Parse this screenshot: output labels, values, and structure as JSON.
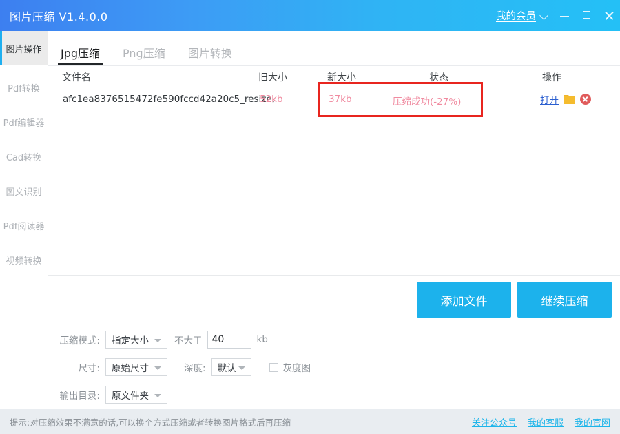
{
  "titlebar": {
    "app_title": "图片压缩 V1.4.0.0",
    "member_link": "我的会员",
    "chevron_icon": "chevron-down-icon",
    "minimize_icon": "minimize-icon",
    "maximize_icon": "maximize-icon",
    "close_icon": "close-icon",
    "gradient_start": "#3d7ff0",
    "gradient_end": "#24c0f6"
  },
  "sidebar": {
    "items": [
      {
        "label": "图片操作",
        "active": true
      },
      {
        "label": "Pdf转换",
        "active": false
      },
      {
        "label": "Pdf编辑器",
        "active": false
      },
      {
        "label": "Cad转换",
        "active": false
      },
      {
        "label": "图文识别",
        "active": false
      },
      {
        "label": "Pdf阅读器",
        "active": false
      },
      {
        "label": "视频转换",
        "active": false
      }
    ],
    "active_accent": "#1eaff0"
  },
  "tabs": [
    {
      "label": "Jpg压缩",
      "active": true
    },
    {
      "label": "Png压缩",
      "active": false
    },
    {
      "label": "图片转换",
      "active": false
    }
  ],
  "table": {
    "headers": {
      "filename": "文件名",
      "old_size": "旧大小",
      "new_size": "新大小",
      "status": "状态",
      "operation": "操作"
    },
    "rows": [
      {
        "filename": "afc1ea8376515472fe590fccd42a20c5_resize,",
        "old_size": "52kb",
        "new_size": "37kb",
        "status": "压缩成功(-27%)",
        "op_open": "打开",
        "op_folder_icon": "folder-icon",
        "op_delete_icon": "delete-circle-icon"
      }
    ],
    "result_text_color": "#f08ba0"
  },
  "annotation": {
    "type": "red-highlight-box",
    "color": "#e8251f"
  },
  "buttons": {
    "add_file": "添加文件",
    "continue_compress": "继续压缩",
    "accent": "#1cb2ec"
  },
  "settings": {
    "mode_label": "压缩模式:",
    "mode_value": "指定大小",
    "limit_label": "不大于",
    "limit_value": "40",
    "limit_unit": "kb",
    "size_label": "尺寸:",
    "size_value": "原始尺寸",
    "depth_label": "深度:",
    "depth_value": "默认",
    "grayscale_label": "灰度图",
    "grayscale_checked": false,
    "output_label": "输出目录:",
    "output_value": "原文件夹"
  },
  "footer": {
    "tip": "提示:对压缩效果不满意的话,可以换个方式压缩或者转换图片格式后再压缩",
    "links": [
      {
        "label": "关注公众号"
      },
      {
        "label": "我的客服"
      },
      {
        "label": "我的官网"
      }
    ],
    "link_color": "#1db5ea"
  }
}
